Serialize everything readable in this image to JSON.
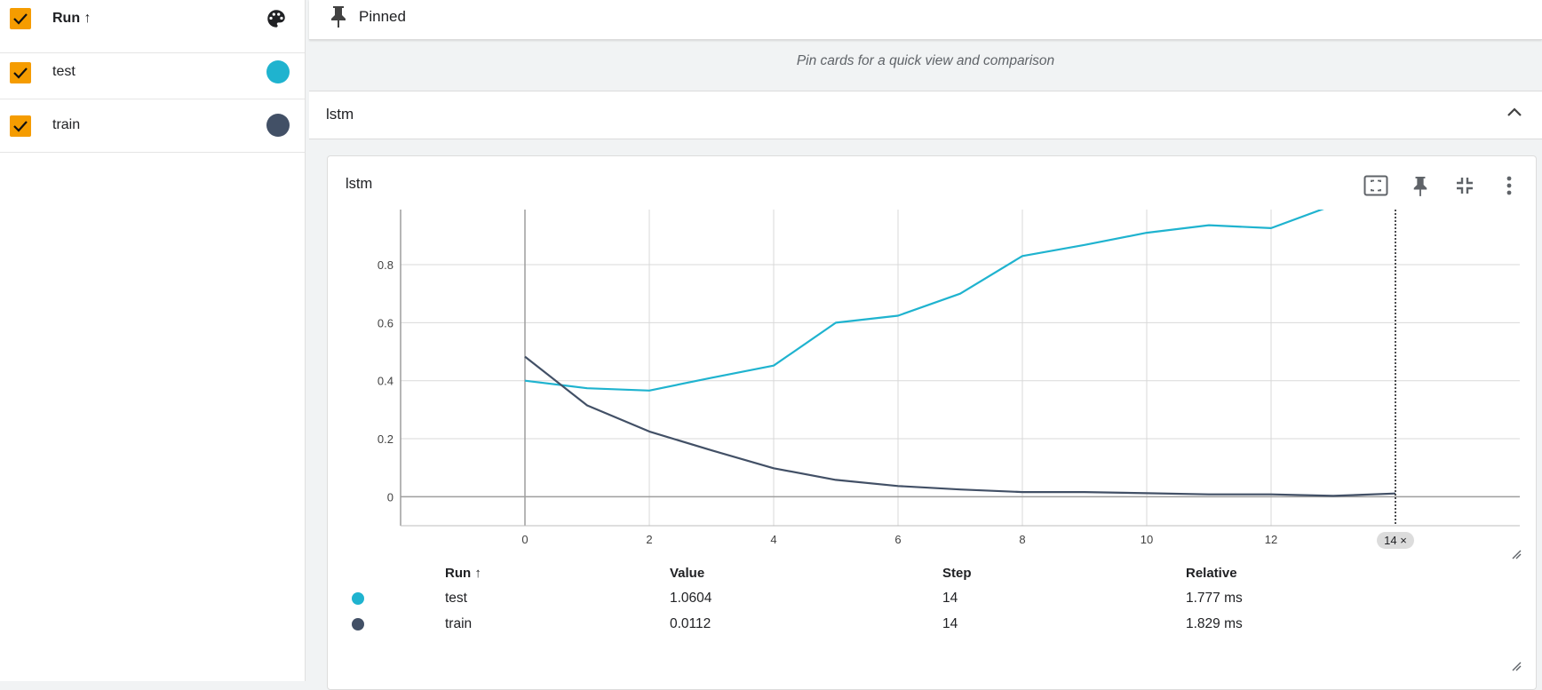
{
  "sidebar": {
    "header_label": "Run ↑",
    "palette_icon": "palette-icon",
    "runs": [
      {
        "label": "test",
        "color": "#1fb3cf"
      },
      {
        "label": "train",
        "color": "#425066"
      }
    ],
    "checkbox_color": "#f59c00"
  },
  "pinned": {
    "title": "Pinned",
    "hint": "Pin cards for a quick view and comparison"
  },
  "group": {
    "title": "lstm"
  },
  "card": {
    "title": "lstm",
    "tools": [
      "fit-domain-icon",
      "pin-icon",
      "collapse-icon",
      "more-vert-icon"
    ],
    "cursor_label": "14 ×"
  },
  "chart_data": {
    "type": "line",
    "xlim": [
      -2,
      16
    ],
    "ylim": [
      -0.1,
      0.99
    ],
    "x_ticks": [
      0,
      2,
      4,
      6,
      8,
      10,
      12
    ],
    "y_ticks": [
      0,
      0.2,
      0.4,
      0.6,
      0.8
    ],
    "y_tick_labels": [
      "0",
      "0.2",
      "0.4",
      "0.6",
      "0.8"
    ],
    "grid": true,
    "cursor_step": 14,
    "series": [
      {
        "name": "test",
        "color": "#1fb3cf",
        "x": [
          0,
          1,
          2,
          3,
          4,
          5,
          6,
          7,
          8,
          9,
          10,
          11,
          12,
          13,
          14
        ],
        "y": [
          0.4,
          0.374,
          0.366,
          0.41,
          0.452,
          0.6,
          0.624,
          0.7,
          0.83,
          0.868,
          0.91,
          0.936,
          0.926,
          1.005,
          1.0604
        ]
      },
      {
        "name": "train",
        "color": "#425066",
        "x": [
          0,
          1,
          2,
          3,
          4,
          5,
          6,
          7,
          8,
          9,
          10,
          11,
          12,
          13,
          14
        ],
        "y": [
          0.483,
          0.315,
          0.225,
          0.16,
          0.098,
          0.058,
          0.037,
          0.025,
          0.016,
          0.016,
          0.012,
          0.008,
          0.008,
          0.003,
          0.0112
        ]
      }
    ]
  },
  "table": {
    "headers": {
      "run": "Run ↑",
      "value": "Value",
      "step": "Step",
      "relative": "Relative"
    },
    "rows": [
      {
        "run": "test",
        "color": "#1fb3cf",
        "value": "1.0604",
        "step": "14",
        "relative": "1.777 ms"
      },
      {
        "run": "train",
        "color": "#425066",
        "value": "0.0112",
        "step": "14",
        "relative": "1.829 ms"
      }
    ]
  }
}
